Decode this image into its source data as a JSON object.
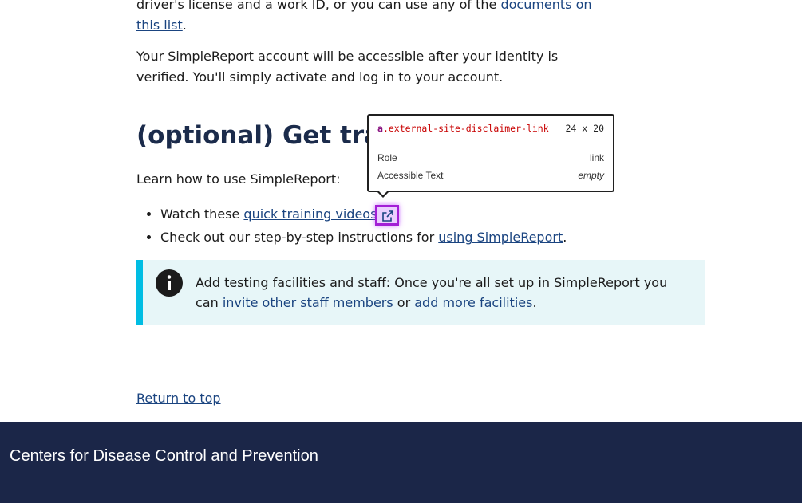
{
  "content": {
    "para1": {
      "text": "driver's license and a work ID, or you can use any of the ",
      "link": "documents on this list",
      "end": "."
    },
    "para2": "Your SimpleReport account will be accessible after your identity is verified. You'll simply activate and log in to your account.",
    "heading_visible": "(optional) Get train",
    "learn": "Learn how to use SimpleReport:",
    "list": [
      {
        "prefix": "Watch these ",
        "link": "quick training videos",
        "suffix": ""
      },
      {
        "prefix": "Check out our step-by-step instructions for ",
        "link": "using SimpleReport",
        "suffix": "."
      }
    ],
    "alert": {
      "text": "Add testing facilities and staff: Once you're all set up in SimpleReport you can ",
      "link1": "invite other staff members",
      "mid": " or ",
      "link2": "add more facilities",
      "end": "."
    },
    "return_link": "Return to top"
  },
  "tooltip": {
    "tag": "a",
    "class": ".external-site-disclaimer-link",
    "size": "24 x 20",
    "role_label": "Role",
    "role_value": "link",
    "acc_label": "Accessible Text",
    "acc_value": "empty"
  },
  "footer": {
    "title": "Centers for Disease Control and Prevention"
  },
  "icons": {
    "external_link": "external-link-icon",
    "info": "info-icon"
  },
  "colors": {
    "link": "#1a4480",
    "alert_bg": "#e7f6f8",
    "alert_border": "#00bde3",
    "footer_bg": "#1b2648",
    "highlight": "#a31fd6"
  }
}
